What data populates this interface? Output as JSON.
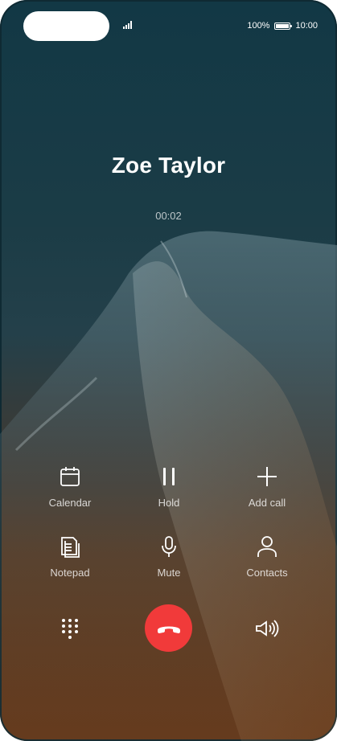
{
  "status_bar": {
    "battery_percent": "100%",
    "time": "10:00",
    "signal_icon": "signal-icon",
    "battery_icon": "battery-icon"
  },
  "call": {
    "contact_name": "Zoe Taylor",
    "duration": "00:02"
  },
  "actions": {
    "calendar": {
      "label": "Calendar",
      "icon": "calendar-icon"
    },
    "hold": {
      "label": "Hold",
      "icon": "pause-icon"
    },
    "add_call": {
      "label": "Add call",
      "icon": "plus-icon"
    },
    "notepad": {
      "label": "Notepad",
      "icon": "notepad-icon"
    },
    "mute": {
      "label": "Mute",
      "icon": "microphone-icon"
    },
    "contacts": {
      "label": "Contacts",
      "icon": "person-icon"
    }
  },
  "bottom_bar": {
    "dialpad_icon": "dialpad-icon",
    "end_call_icon": "phone-hangup-icon",
    "speaker_icon": "speaker-icon",
    "end_call_color": "#f13a3a"
  }
}
